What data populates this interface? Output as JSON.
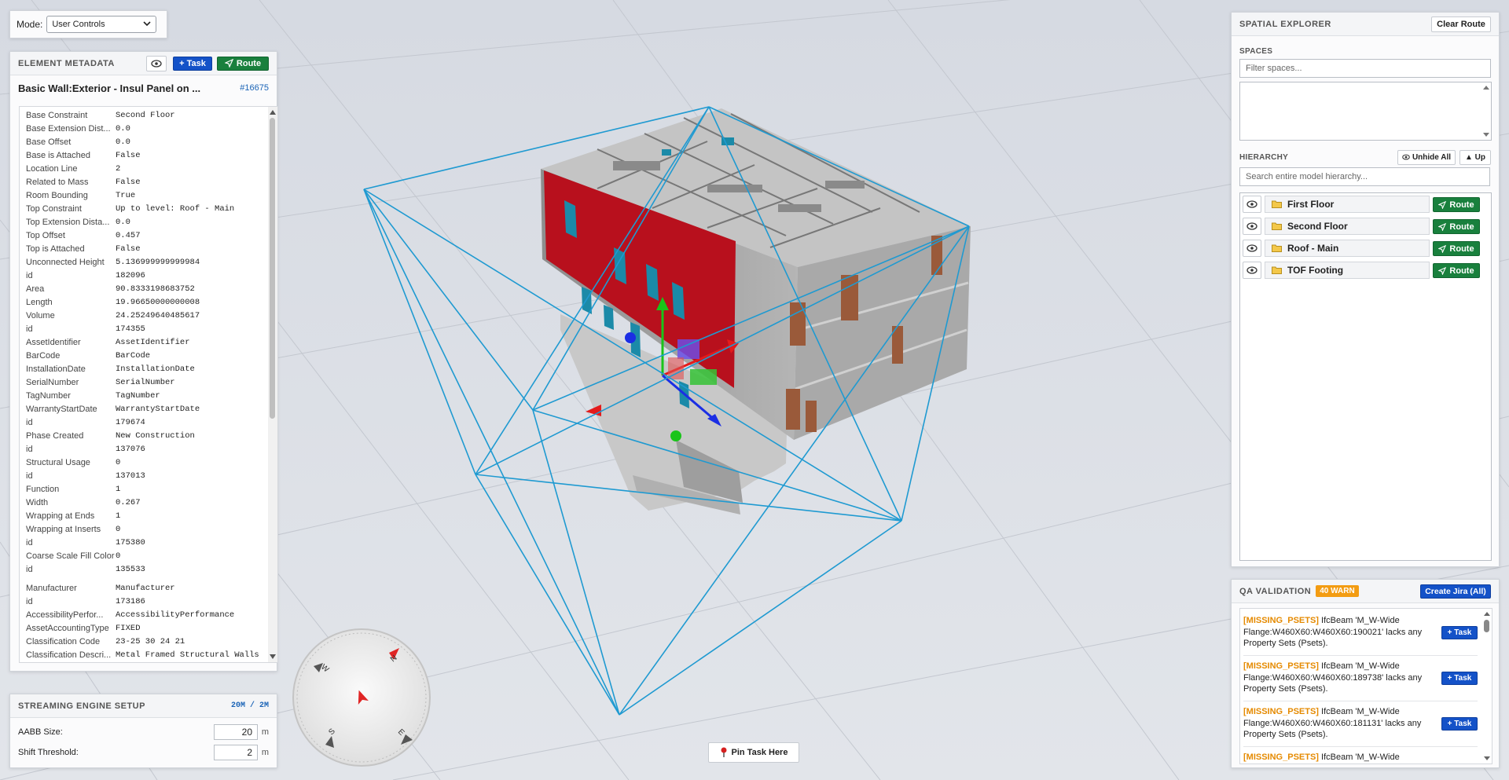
{
  "mode": {
    "label": "Mode:",
    "value": "User Controls"
  },
  "metadata": {
    "title": "ELEMENT METADATA",
    "task_label": "+ Task",
    "route_label": "Route",
    "element_name": "Basic Wall:Exterior - Insul Panel on ...",
    "element_id": "#16675",
    "properties": [
      {
        "k": "Base Constraint",
        "v": "Second Floor"
      },
      {
        "k": "Base Extension Dist...",
        "v": "0.0"
      },
      {
        "k": "Base Offset",
        "v": "0.0"
      },
      {
        "k": "Base is Attached",
        "v": "False"
      },
      {
        "k": "Location Line",
        "v": "2"
      },
      {
        "k": "Related to Mass",
        "v": "False"
      },
      {
        "k": "Room Bounding",
        "v": "True"
      },
      {
        "k": "Top Constraint",
        "v": "Up to level: Roof - Main"
      },
      {
        "k": "Top Extension Dista...",
        "v": "0.0"
      },
      {
        "k": "Top Offset",
        "v": "0.457"
      },
      {
        "k": "Top is Attached",
        "v": "False"
      },
      {
        "k": "Unconnected Height",
        "v": "5.136999999999984"
      },
      {
        "k": "id",
        "v": "182096"
      },
      {
        "k": "Area",
        "v": "90.8333198683752"
      },
      {
        "k": "Length",
        "v": "19.96650000000008"
      },
      {
        "k": "Volume",
        "v": "24.25249640485617"
      },
      {
        "k": "id",
        "v": "174355"
      },
      {
        "k": "AssetIdentifier",
        "v": "AssetIdentifier"
      },
      {
        "k": "BarCode",
        "v": "BarCode"
      },
      {
        "k": "InstallationDate",
        "v": "InstallationDate"
      },
      {
        "k": "SerialNumber",
        "v": "SerialNumber"
      },
      {
        "k": "TagNumber",
        "v": "TagNumber"
      },
      {
        "k": "WarrantyStartDate",
        "v": "WarrantyStartDate"
      },
      {
        "k": "id",
        "v": "179674"
      },
      {
        "k": "Phase Created",
        "v": "New Construction"
      },
      {
        "k": "id",
        "v": "137076"
      },
      {
        "k": "Structural Usage",
        "v": "0"
      },
      {
        "k": "id",
        "v": "137013"
      },
      {
        "k": "Function",
        "v": "1"
      },
      {
        "k": "Width",
        "v": "0.267"
      },
      {
        "k": "Wrapping at Ends",
        "v": "1"
      },
      {
        "k": "Wrapping at Inserts",
        "v": "0"
      },
      {
        "k": "id",
        "v": "175380"
      },
      {
        "k": "Coarse Scale Fill Color",
        "v": "0"
      },
      {
        "k": "id",
        "v": "135533"
      },
      {
        "k": "",
        "v": ""
      },
      {
        "k": "Manufacturer",
        "v": "Manufacturer"
      },
      {
        "k": "id",
        "v": "173186"
      },
      {
        "k": "AccessibilityPerfor...",
        "v": "AccessibilityPerformance"
      },
      {
        "k": "AssetAccountingType",
        "v": "FIXED"
      },
      {
        "k": "Classification Code",
        "v": "23-25 30 24 21"
      },
      {
        "k": "Classification Descri...",
        "v": "Metal Framed Structural Walls"
      }
    ]
  },
  "streaming": {
    "title": "STREAMING ENGINE SETUP",
    "badge": "20M / 2M",
    "aabb_label": "AABB Size:",
    "aabb_value": "20",
    "shift_label": "Shift Threshold:",
    "shift_value": "2",
    "unit": "m"
  },
  "spatial": {
    "title": "SPATIAL EXPLORER",
    "clear_route": "Clear Route",
    "spaces_label": "SPACES",
    "spaces_placeholder": "Filter spaces...",
    "hierarchy_label": "HIERARCHY",
    "unhide_all": "Unhide All",
    "up": "▲ Up",
    "search_placeholder": "Search entire model hierarchy...",
    "route_label": "Route",
    "levels": [
      {
        "name": "First Floor"
      },
      {
        "name": "Second Floor"
      },
      {
        "name": "Roof - Main"
      },
      {
        "name": "TOF Footing"
      }
    ]
  },
  "qa": {
    "title": "QA VALIDATION",
    "warn_badge": "40 WARN",
    "create_jira": "Create Jira (All)",
    "task_label": "+ Task",
    "items": [
      {
        "tag": "[MISSING_PSETS]",
        "text": " IfcBeam 'M_W-Wide Flange:W460X60:W460X60:190021' lacks any Property Sets (Psets)."
      },
      {
        "tag": "[MISSING_PSETS]",
        "text": " IfcBeam 'M_W-Wide Flange:W460X60:W460X60:189738' lacks any Property Sets (Psets)."
      },
      {
        "tag": "[MISSING_PSETS]",
        "text": " IfcBeam 'M_W-Wide Flange:W460X60:W460X60:181131' lacks any Property Sets (Psets)."
      },
      {
        "tag": "[MISSING_PSETS]",
        "text": " IfcBeam 'M_W-Wide"
      }
    ]
  },
  "compass": {
    "n": "N",
    "e": "E",
    "s": "S",
    "w": "W"
  },
  "pin": {
    "label": "Pin Task Here"
  },
  "colors": {
    "accent_blue": "#1452c8",
    "route_green": "#19803d",
    "warn_orange": "#e58a00",
    "wireframe": "#1f9ad1",
    "facade_red": "#b8101d"
  }
}
